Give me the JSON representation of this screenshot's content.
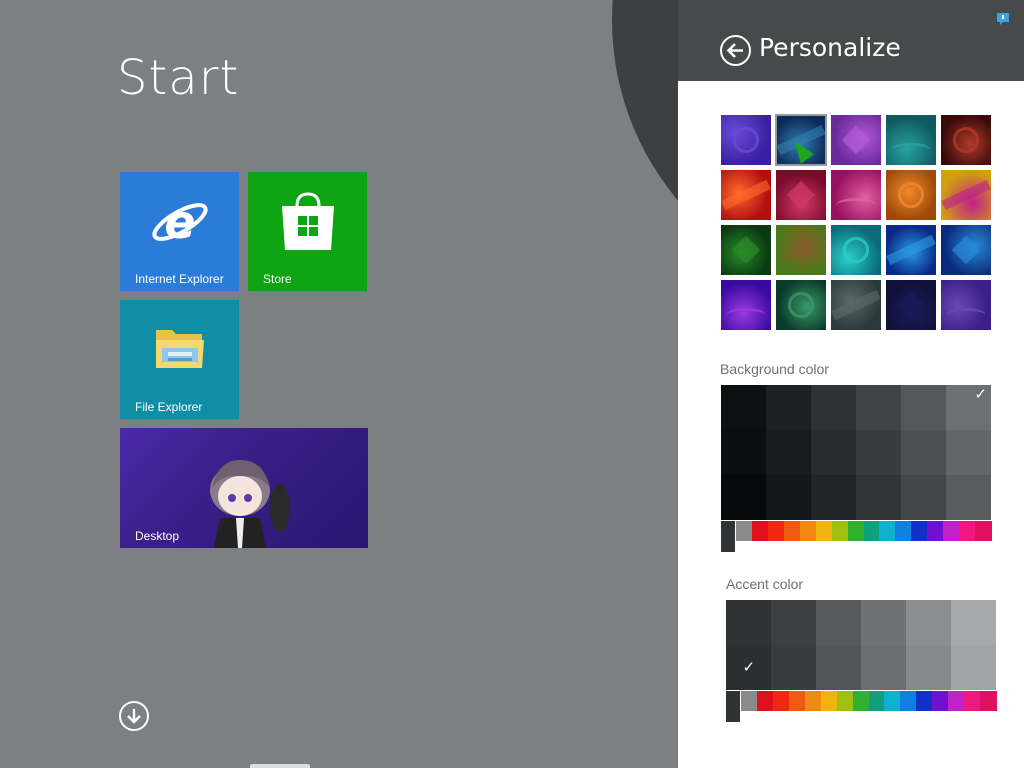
{
  "start": {
    "title": "Start",
    "tiles": [
      {
        "label": "Internet Explorer",
        "icon": "internet-explorer-icon",
        "color": "#2b7cd8"
      },
      {
        "label": "Store",
        "icon": "store-icon",
        "color": "#0ea414"
      },
      {
        "label": "File Explorer",
        "icon": "folder-icon",
        "color": "#0f8ea5"
      },
      {
        "label": "Desktop",
        "icon": "desktop-wallpaper",
        "color": "#3a1f88"
      }
    ],
    "all_apps_icon": "down-arrow-circle-icon",
    "background": "#7c8082",
    "arc_color": "#3d4040"
  },
  "pane": {
    "title": "Personalize",
    "back_icon": "back-arrow-circle-icon",
    "header_color": "#474a4a",
    "notify_icon": "notification-icon",
    "background_label": "Background color",
    "accent_label": "Accent color",
    "patterns": [
      {
        "name": "purple-curtain",
        "c1": "#3a1fa0",
        "c2": "#6a4ad8"
      },
      {
        "name": "gears",
        "c1": "#0d2a5a",
        "c2": "#2f7fb0"
      },
      {
        "name": "castle",
        "c1": "#6a2a9a",
        "c2": "#b25ad8"
      },
      {
        "name": "teal-swirls",
        "c1": "#0f5a5e",
        "c2": "#29a2a0"
      },
      {
        "name": "red-rose",
        "c1": "#3a0a0a",
        "c2": "#b03a2a"
      },
      {
        "name": "red-swirl",
        "c1": "#b01010",
        "c2": "#ff6a2a"
      },
      {
        "name": "dark-red-bird",
        "c1": "#7a0c2a",
        "c2": "#d0386a"
      },
      {
        "name": "pink-flowers",
        "c1": "#9a1060",
        "c2": "#e060a0"
      },
      {
        "name": "orange-snail",
        "c1": "#a04a0a",
        "c2": "#f08a2a"
      },
      {
        "name": "yellow-magenta",
        "c1": "#d0a010",
        "c2": "#c0208a"
      },
      {
        "name": "green-leaf",
        "c1": "#0a3a12",
        "c2": "#2a8a2a"
      },
      {
        "name": "brown-creature",
        "c1": "#4a7a1a",
        "c2": "#8a5a2a"
      },
      {
        "name": "teal-star",
        "c1": "#0a6a7a",
        "c2": "#2ad0c8"
      },
      {
        "name": "blue-streak",
        "c1": "#0a2a8a",
        "c2": "#2a9ae0"
      },
      {
        "name": "blue-waves",
        "c1": "#0a2a7a",
        "c2": "#2a8ad8"
      },
      {
        "name": "purple-haze",
        "c1": "#3a0aa0",
        "c2": "#9a3ae0"
      },
      {
        "name": "flower-pattern",
        "c1": "#0a3a2a",
        "c2": "#3a9a6a"
      },
      {
        "name": "gray-gears",
        "c1": "#2a3a3a",
        "c2": "#5a6a6a"
      },
      {
        "name": "dark-navy",
        "c1": "#10103a",
        "c2": "#1a1a5a"
      },
      {
        "name": "anime-character",
        "c1": "#3a1f88",
        "c2": "#6a4ab0"
      }
    ],
    "selected_pattern_index": 1,
    "bg_shades": [
      [
        "#0b1011",
        "#1c2122",
        "#2d3232",
        "#3f4444",
        "#545859",
        "#6c7071"
      ],
      [
        "#090e0f",
        "#181c1d",
        "#272c2c",
        "#383c3d",
        "#4c5051",
        "#626667"
      ],
      [
        "#050909",
        "#131717",
        "#212525",
        "#313535",
        "#434747",
        "#585c5c"
      ]
    ],
    "bg_selected": [
      0,
      5
    ],
    "accent_shades": [
      [
        "#2f3333",
        "#3c4040",
        "#565a5a",
        "#6e7272",
        "#8a8e8e",
        "#a5a9a9"
      ],
      [
        "#2b2f2f",
        "#383c3c",
        "#515555",
        "#696d6d",
        "#858989",
        "#a0a4a4"
      ]
    ],
    "accent_selected": [
      1,
      0
    ],
    "check_glyph": "✓",
    "hues": [
      "#8a8a8a",
      "#e0101c",
      "#f02810",
      "#f05a10",
      "#f08a10",
      "#f0b410",
      "#a0c010",
      "#30b030",
      "#10a080",
      "#10b0d0",
      "#1080e0",
      "#1030c8",
      "#7010d0",
      "#c020c8",
      "#f01880",
      "#e01060"
    ]
  }
}
